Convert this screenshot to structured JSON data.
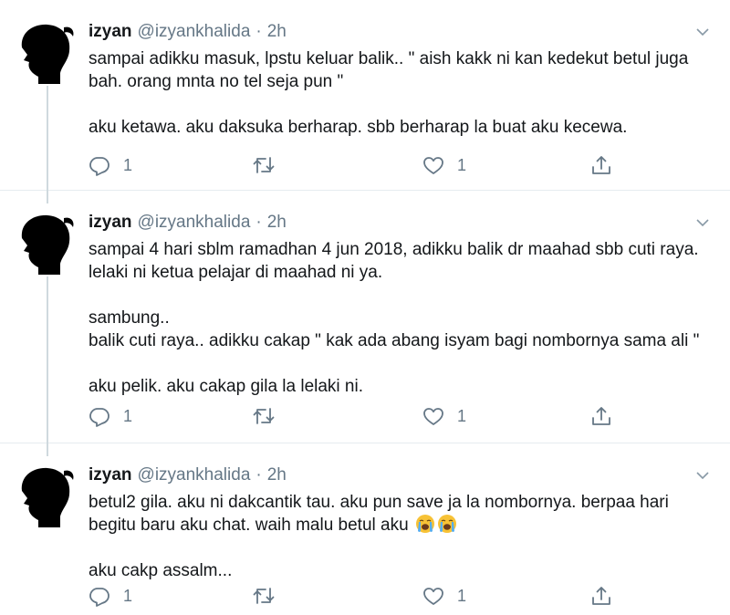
{
  "colors": {
    "text": "#14171a",
    "secondary": "#657786",
    "icon": "#657786",
    "divider": "#e6ecf0"
  },
  "tweets": [
    {
      "name": "izyan",
      "handle": "@izyankhalida",
      "dot": "·",
      "time": "2h",
      "lines": [
        "sampai adikku masuk, lpstu keluar balik..  \" aish kakk ni kan kedekut betul juga",
        "bah.  orang mnta no tel seja pun \"",
        "",
        "aku ketawa. aku daksuka berharap. sbb berharap la buat aku kecewa."
      ],
      "reply_count": "1",
      "retweet_count": "",
      "like_count": "1",
      "icons": [
        "reply-icon",
        "retweet-icon",
        "like-icon",
        "share-icon"
      ]
    },
    {
      "name": "izyan",
      "handle": "@izyankhalida",
      "dot": "·",
      "time": "2h",
      "lines": [
        "sampai 4 hari sblm ramadhan 4 jun 2018, adikku balik dr maahad sbb cuti raya.",
        "lelaki ni ketua pelajar di maahad ni ya.",
        "",
        "sambung..",
        "balik cuti raya..  adikku cakap \" kak ada abang isyam bagi nombornya sama ali \"",
        "",
        "aku pelik. aku cakap gila la lelaki ni."
      ],
      "reply_count": "1",
      "retweet_count": "",
      "like_count": "1",
      "icons": [
        "reply-icon",
        "retweet-icon",
        "like-icon",
        "share-icon"
      ]
    },
    {
      "name": "izyan",
      "handle": "@izyankhalida",
      "dot": "·",
      "time": "2h",
      "lines": [
        "betul2 gila. aku ni dakcantik tau. aku pun save ja la nombornya.  berpaa hari",
        "begitu baru aku chat.  waih malu betul aku",
        "",
        "aku cakp assalm..."
      ],
      "emoji": [
        "loudly-crying-face-emoji",
        "loudly-crying-face-emoji"
      ],
      "reply_count": "1",
      "retweet_count": "",
      "like_count": "1",
      "icons": [
        "reply-icon",
        "retweet-icon",
        "like-icon",
        "share-icon"
      ]
    }
  ]
}
